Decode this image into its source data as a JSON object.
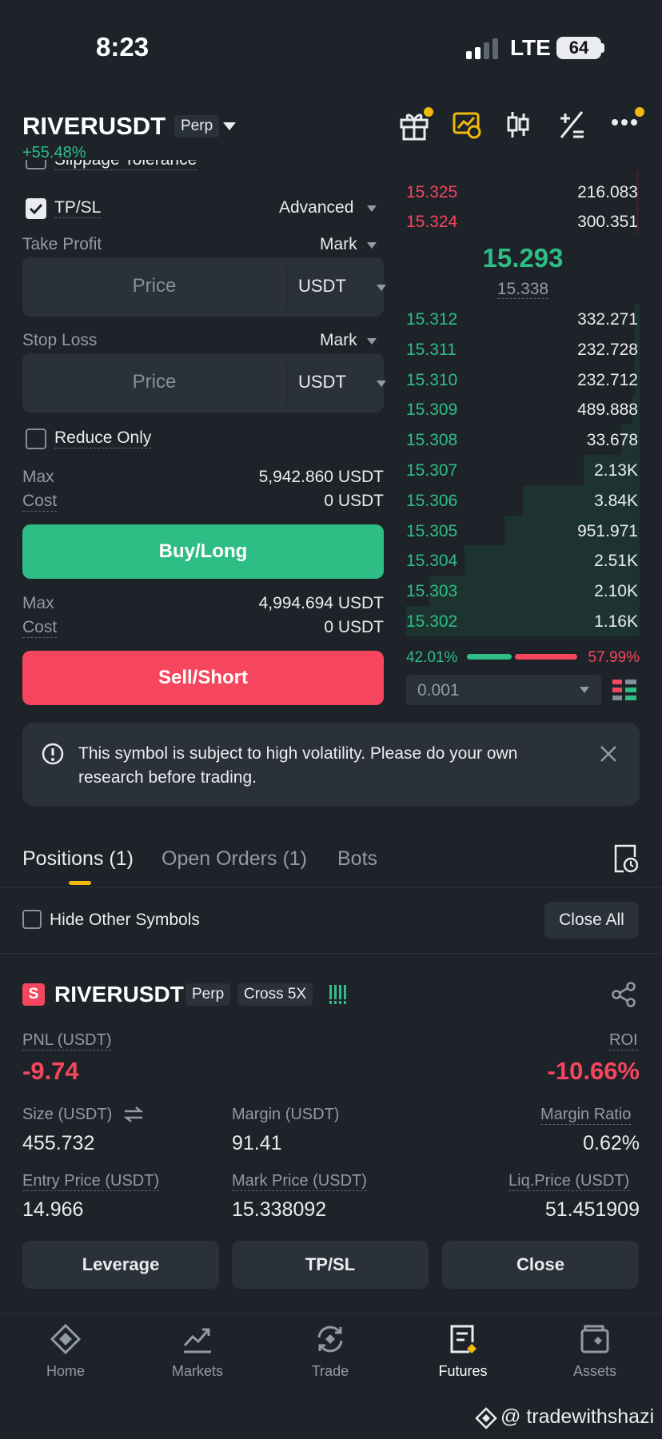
{
  "status_bar": {
    "time": "8:23",
    "network": "LTE",
    "battery": "64"
  },
  "header": {
    "symbol": "RIVERUSDT",
    "contract": "Perp",
    "change": "+55.48%"
  },
  "order_form": {
    "slippage_label": "Slippage Tolerance",
    "tpsl_label": "TP/SL",
    "advanced_label": "Advanced",
    "take_profit": {
      "label": "Take Profit",
      "trigger": "Mark",
      "placeholder": "Price",
      "unit": "USDT"
    },
    "stop_loss": {
      "label": "Stop Loss",
      "trigger": "Mark",
      "placeholder": "Price",
      "unit": "USDT"
    },
    "reduce_only_label": "Reduce Only",
    "buy": {
      "max_label": "Max",
      "max_value": "5,942.860 USDT",
      "cost_label": "Cost",
      "cost_value": "0 USDT",
      "button": "Buy/Long"
    },
    "sell": {
      "max_label": "Max",
      "max_value": "4,994.694 USDT",
      "cost_label": "Cost",
      "cost_value": "0 USDT",
      "button": "Sell/Short"
    }
  },
  "order_book": {
    "asks": [
      {
        "price": "15.325",
        "qty": "216.083"
      },
      {
        "price": "15.324",
        "qty": "300.351"
      }
    ],
    "last_price": "15.293",
    "mark_price": "15.338",
    "bids": [
      {
        "price": "15.312",
        "qty": "332.271",
        "depth": 0.02
      },
      {
        "price": "15.311",
        "qty": "232.728",
        "depth": 0.02
      },
      {
        "price": "15.310",
        "qty": "232.712",
        "depth": 0.02
      },
      {
        "price": "15.309",
        "qty": "489.888",
        "depth": 0.03
      },
      {
        "price": "15.308",
        "qty": "33.678",
        "depth": 0.08
      },
      {
        "price": "15.307",
        "qty": "2.13K",
        "depth": 0.24
      },
      {
        "price": "15.306",
        "qty": "3.84K",
        "depth": 0.5
      },
      {
        "price": "15.305",
        "qty": "951.971",
        "depth": 0.58
      },
      {
        "price": "15.304",
        "qty": "2.51K",
        "depth": 0.75
      },
      {
        "price": "15.303",
        "qty": "2.10K",
        "depth": 0.9
      },
      {
        "price": "15.302",
        "qty": "1.16K",
        "depth": 1.0
      }
    ],
    "buy_ratio": "42.01%",
    "sell_ratio": "57.99%",
    "buy_fraction": 0.4201,
    "precision": "0.001"
  },
  "notice": {
    "text": "This symbol is subject to high volatility. Please do your own research before trading."
  },
  "tabs": [
    {
      "label": "Positions (1)"
    },
    {
      "label": "Open Orders (1)"
    },
    {
      "label": "Bots"
    }
  ],
  "filters": {
    "hide_other_label": "Hide Other Symbols",
    "close_all_label": "Close All"
  },
  "position": {
    "side": "S",
    "symbol": "RIVERUSDT",
    "contract": "Perp",
    "margin_mode": "Cross 5X",
    "pnl_label": "PNL (USDT)",
    "pnl": "-9.74",
    "roi_label": "ROI",
    "roi": "-10.66%",
    "size_label": "Size (USDT)",
    "size": "455.732",
    "margin_label": "Margin (USDT)",
    "margin": "91.41",
    "margin_ratio_label": "Margin Ratio",
    "margin_ratio": "0.62%",
    "entry_label": "Entry Price (USDT)",
    "entry": "14.966",
    "mark_label": "Mark Price (USDT)",
    "mark": "15.338092",
    "liq_label": "Liq.Price (USDT)",
    "liq": "51.451909",
    "buttons": {
      "leverage": "Leverage",
      "tpsl": "TP/SL",
      "close": "Close"
    }
  },
  "bottom_nav": [
    {
      "label": "Home",
      "icon": "home-icon"
    },
    {
      "label": "Markets",
      "icon": "markets-icon"
    },
    {
      "label": "Trade",
      "icon": "trade-icon"
    },
    {
      "label": "Futures",
      "icon": "futures-icon",
      "active": true
    },
    {
      "label": "Assets",
      "icon": "assets-icon"
    }
  ],
  "watermark": "@ tradewithshazi",
  "colors": {
    "background": "#1e2329",
    "green": "#2ebd85",
    "red": "#f6465d",
    "accent": "#f0b90b"
  }
}
